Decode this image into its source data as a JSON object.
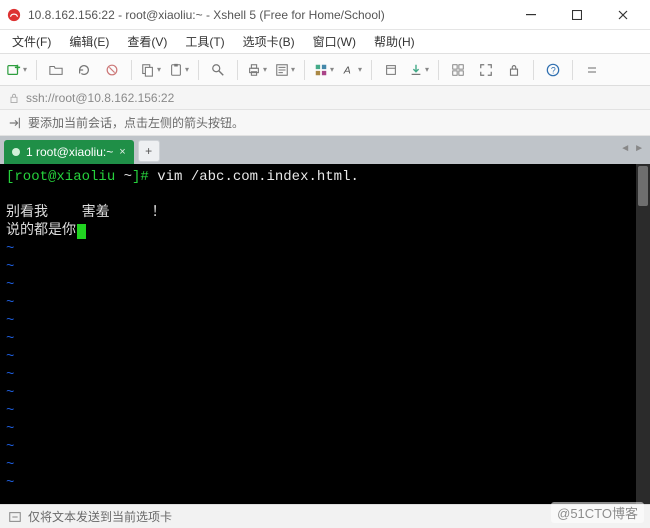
{
  "window": {
    "title": "10.8.162.156:22 - root@xiaoliu:~ - Xshell 5 (Free for Home/School)"
  },
  "menu": {
    "file": "文件(F)",
    "edit": "编辑(E)",
    "view": "查看(V)",
    "tools": "工具(T)",
    "options": "选项卡(B)",
    "window": "窗口(W)",
    "help": "帮助(H)"
  },
  "address": {
    "url": "ssh://root@10.8.162.156:22"
  },
  "hint": {
    "text": "要添加当前会话，点击左侧的箭头按钮。"
  },
  "tab": {
    "label": "1 root@xiaoliu:~",
    "add_label": "+"
  },
  "tab_nav": {
    "left": "◄",
    "right": "►"
  },
  "terminal": {
    "prompt_user": "[root@xiaoliu ",
    "prompt_path_sym": "~",
    "prompt_tail": "]# ",
    "command": "vim /abc.com.index.html.",
    "line_blank": " ",
    "body1": "别看我    害羞     ！",
    "body2": "说的都是你",
    "tilde": "~"
  },
  "status": {
    "text": "仅将文本发送到当前选项卡"
  },
  "watermark": "@51CTO博客"
}
